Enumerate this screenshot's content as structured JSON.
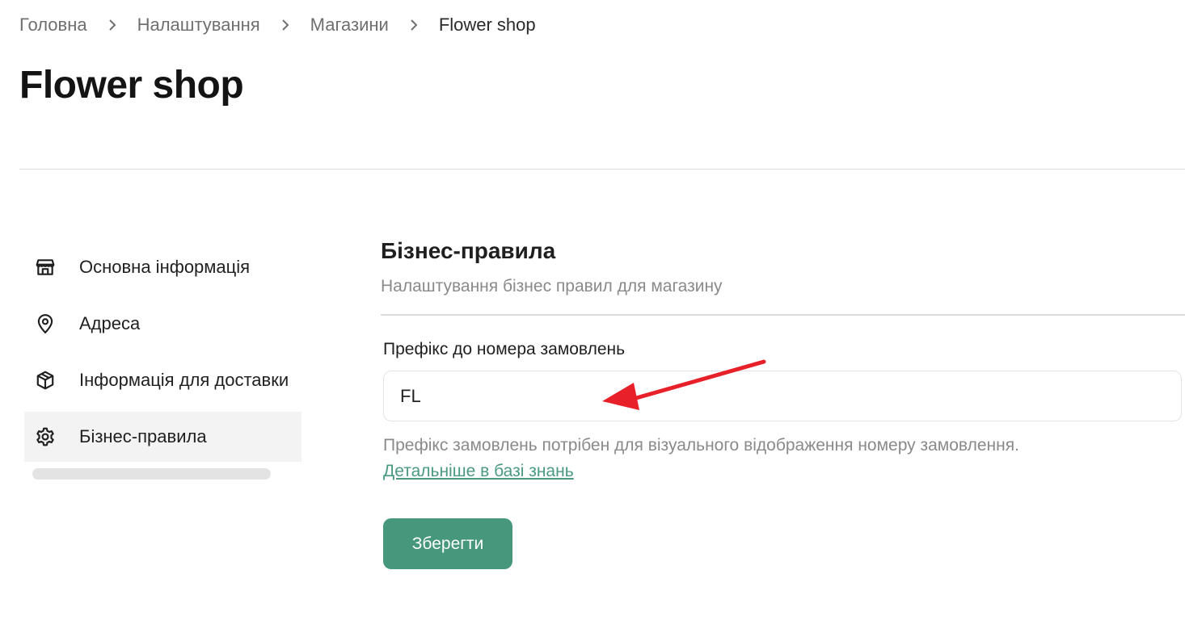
{
  "breadcrumb": {
    "items": [
      "Головна",
      "Налаштування",
      "Магазини",
      "Flower shop"
    ],
    "separator_icon": "chevron-right-icon"
  },
  "page": {
    "title": "Flower shop"
  },
  "sidebar": {
    "items": [
      {
        "label": "Основна інформація",
        "icon": "store-icon",
        "active": false
      },
      {
        "label": "Адреса",
        "icon": "map-pin-icon",
        "active": false
      },
      {
        "label": "Інформація для доставки",
        "icon": "package-icon",
        "active": false
      },
      {
        "label": "Бізнес-правила",
        "icon": "gear-icon",
        "active": true
      }
    ]
  },
  "main": {
    "section_title": "Бізнес-правила",
    "section_subtitle": "Налаштування бізнес правил для магазину",
    "field_label": "Префікс до номера замовлень",
    "field_value": "FL",
    "helper_text": "Префікс замовлень потрібен для візуального відображення номеру замовлення.",
    "helper_link": "Детальніше в базі знань",
    "save_label": "Зберегти"
  },
  "colors": {
    "accent": "#46977c",
    "link": "#4a9a80",
    "annotation": "#e8202a",
    "active_bg": "#f3f3f3"
  }
}
